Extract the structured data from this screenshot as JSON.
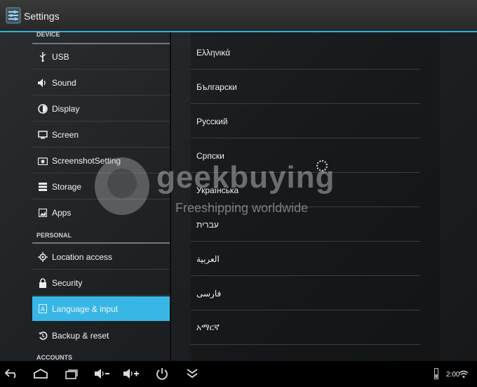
{
  "window": {
    "title": "Settings"
  },
  "sidebar": {
    "sections": [
      {
        "header": "DEVICE"
      },
      {
        "header": "PERSONAL"
      },
      {
        "header": "ACCOUNTS"
      }
    ],
    "items": [
      {
        "label": "USB",
        "icon": "usb-icon"
      },
      {
        "label": "Sound",
        "icon": "speaker-icon"
      },
      {
        "label": "Display",
        "icon": "brightness-icon"
      },
      {
        "label": "Screen",
        "icon": "screen-icon"
      },
      {
        "label": "ScreenshotSetting",
        "icon": "camera-icon"
      },
      {
        "label": "Storage",
        "icon": "storage-icon"
      },
      {
        "label": "Apps",
        "icon": "apps-icon"
      },
      {
        "label": "Location access",
        "icon": "location-icon"
      },
      {
        "label": "Security",
        "icon": "lock-icon"
      },
      {
        "label": "Language & input",
        "icon": "keyboard-icon",
        "selected": true
      },
      {
        "label": "Backup & reset",
        "icon": "backup-icon"
      }
    ]
  },
  "languages": [
    "Ελληνικά",
    "Български",
    "Русский",
    "Српски",
    "Українська",
    "עברית",
    "العربية",
    "فارسی",
    "አማርኛ"
  ],
  "watermark": {
    "brand": "geekbuying",
    "tagline": "Freeshipping worldwide"
  },
  "statusbar": {
    "time": "2:00"
  },
  "colors": {
    "accent": "#38b7e6",
    "divider": "#2fb3de",
    "background": "#1e2124"
  }
}
